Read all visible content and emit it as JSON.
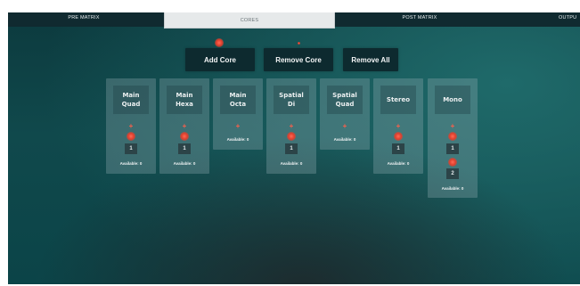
{
  "tabs": [
    {
      "label": "PRE MATRIX",
      "active": false
    },
    {
      "label": "CORES",
      "active": true
    },
    {
      "label": "POST MATRIX",
      "active": false
    },
    {
      "label": "OUTPU",
      "active": false
    }
  ],
  "toolbar": {
    "add_core_label": "Add Core",
    "remove_core_label": "Remove Core",
    "remove_all_label": "Remove All"
  },
  "cores": [
    {
      "title": "Main\nQuad",
      "plus": "+",
      "slots": [
        "1"
      ],
      "available": "Available: 0"
    },
    {
      "title": "Main\nHexa",
      "plus": "+",
      "slots": [
        "1"
      ],
      "available": "Available: 0"
    },
    {
      "title": "Main\nOcta",
      "plus": "+",
      "slots": [],
      "available": "Available: 0"
    },
    {
      "title": "Spatial\nDi",
      "plus": "+",
      "slots": [
        "1"
      ],
      "available": "Available: 0"
    },
    {
      "title": "Spatial\nQuad",
      "plus": "+",
      "slots": [],
      "available": "Available: 0"
    },
    {
      "title": "Stereo",
      "plus": "+",
      "slots": [
        "1"
      ],
      "available": "Available: 0"
    },
    {
      "title": "Mono",
      "plus": "+",
      "slots": [
        "1",
        "2"
      ],
      "available": "Available: 0"
    }
  ],
  "colors": {
    "accent_dot": "#e0402e",
    "plus": "#ff5f4a",
    "button_bg": "#0d2a2f",
    "card_bg": "#96afb4"
  }
}
